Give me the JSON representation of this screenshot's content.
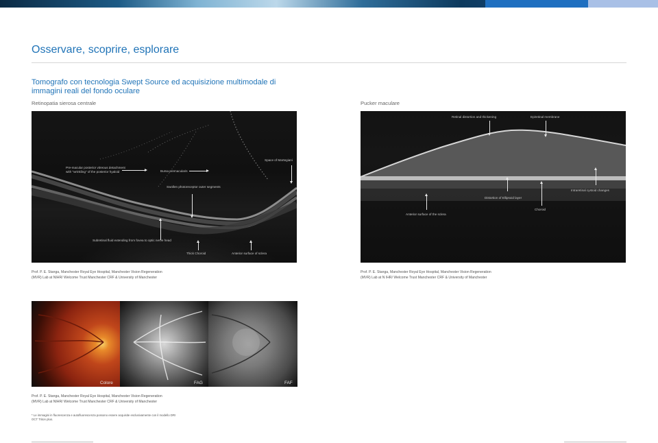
{
  "page": {
    "title": "Osservare, scoprire, esplorare",
    "subtitle": "Tomografo con tecnologia Swept Source ed acquisizione multimodale di immagini reali del fondo oculare"
  },
  "left_section": {
    "label": "Retinopatia sierosa centrale",
    "annotations": {
      "premacular": "Pre-macular posterior vitreous detachment\nwith \"wrinkling\" of the posterior hyaloid",
      "bursa": "Bursa premacularis",
      "martegiani": "Space of Martegiani",
      "swollen": "Swollen photoreceptor outer segments",
      "subretinal": "Subretinal fluid extending from fovea to optic nerve head",
      "thick_choroid": "Thick Choroid",
      "anterior_sclera": "Anterior surface of sclera"
    },
    "credit": "Prof. P. E. Stanga, Manchester Royal Eye Hospital, Manchester Vision Regeneration (MVR) Lab at NIHR/ Welcome Trust Manchester CRF & University of Manchester"
  },
  "right_section": {
    "label": "Pucker maculare",
    "annotations": {
      "retinal_distortion": "Retinal distortion and thickening",
      "epiretinal": "Epiretinal membrane",
      "intraretinal": "Intraretinal cystoid changes",
      "ellipsoid": "Distortion of Ellipsoid layer",
      "choroid": "Choroid",
      "anterior_sclera": "Anterior surface of the sclera"
    },
    "credit": "Prof. P. E. Stanga, Manchester Royal Eye Hospital, Manchester Vision Regeneration (MVR) Lab at N IHR/ Welcome Trust Manchester CRF & University of Manchester"
  },
  "fundus": {
    "captions": [
      "Colore",
      "FAG",
      "FAF"
    ],
    "credit": "Prof. P. E. Stanga, Manchester Royal Eye Hospital, Manchester Vision Regeneration (MVR) Lab at NIHR/ Welcome Trust Manchester CRF & University of Manchester"
  },
  "footnote": "* Le immagini in fluorescenza e autofluorescenza possono essere acquisite esclusivamente con il modello DRI OCT Triton plus.",
  "colors": {
    "accent": "#1f73b7",
    "brand_blue": "#1f6fc0"
  }
}
